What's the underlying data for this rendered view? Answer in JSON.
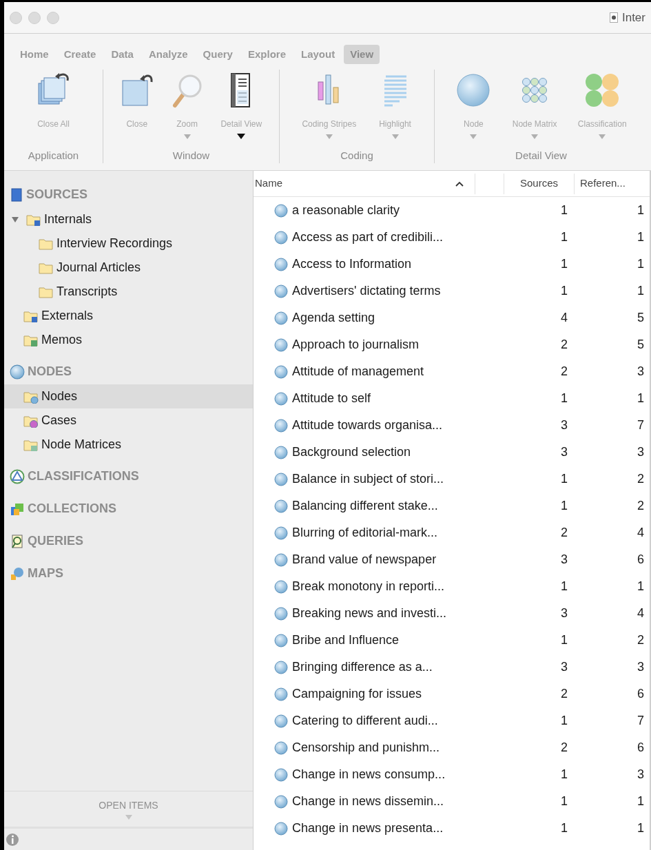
{
  "window": {
    "title": "Inter"
  },
  "ribbon": {
    "tabs": [
      {
        "label": "Home",
        "selected": false
      },
      {
        "label": "Create",
        "selected": false
      },
      {
        "label": "Data",
        "selected": false
      },
      {
        "label": "Analyze",
        "selected": false
      },
      {
        "label": "Query",
        "selected": false
      },
      {
        "label": "Explore",
        "selected": false
      },
      {
        "label": "Layout",
        "selected": false
      },
      {
        "label": "View",
        "selected": true
      }
    ],
    "groups": [
      {
        "label": "Application",
        "buttons": [
          {
            "label": "Close All",
            "kind": "close-all",
            "dropdown": false
          }
        ]
      },
      {
        "label": "Window",
        "buttons": [
          {
            "label": "Close",
            "kind": "close",
            "dropdown": false
          },
          {
            "label": "Zoom",
            "kind": "zoom",
            "dropdown": true,
            "menu_enabled": false
          },
          {
            "label": "Detail View",
            "kind": "detail-view",
            "dropdown": true,
            "menu_enabled": true
          }
        ]
      },
      {
        "label": "Coding",
        "buttons": [
          {
            "label": "Coding Stripes",
            "kind": "coding-stripes",
            "dropdown": true,
            "menu_enabled": false
          },
          {
            "label": "Highlight",
            "kind": "highlight",
            "dropdown": true,
            "menu_enabled": false
          }
        ]
      },
      {
        "label": "Detail View",
        "buttons": [
          {
            "label": "Node",
            "kind": "node",
            "dropdown": true,
            "menu_enabled": false
          },
          {
            "label": "Node Matrix",
            "kind": "node-matrix",
            "dropdown": true,
            "menu_enabled": false
          },
          {
            "label": "Classification",
            "kind": "classification",
            "dropdown": true,
            "menu_enabled": false
          }
        ]
      }
    ]
  },
  "sidebar": {
    "sections": [
      {
        "label": "SOURCES",
        "kind": "sources",
        "items": [
          {
            "label": "Internals",
            "kind": "internals",
            "selected": false,
            "expanded": true,
            "children": [
              {
                "label": "Interview Recordings",
                "selected": false
              },
              {
                "label": "Journal Articles",
                "selected": false
              },
              {
                "label": "Transcripts",
                "selected": false
              }
            ]
          },
          {
            "label": "Externals",
            "kind": "externals",
            "selected": false
          },
          {
            "label": "Memos",
            "kind": "memos",
            "selected": false
          }
        ]
      },
      {
        "label": "NODES",
        "kind": "nodes",
        "items": [
          {
            "label": "Nodes",
            "kind": "nodes",
            "selected": true
          },
          {
            "label": "Cases",
            "kind": "cases",
            "selected": false
          },
          {
            "label": "Node Matrices",
            "kind": "matrices",
            "selected": false
          }
        ]
      },
      {
        "label": "CLASSIFICATIONS",
        "kind": "classifications"
      },
      {
        "label": "COLLECTIONS",
        "kind": "collections"
      },
      {
        "label": "QUERIES",
        "kind": "queries"
      },
      {
        "label": "MAPS",
        "kind": "maps"
      }
    ],
    "footer": {
      "label": "OPEN ITEMS"
    }
  },
  "table": {
    "columns": [
      {
        "label": "Name",
        "sorted": true
      },
      {
        "label": "Sources"
      },
      {
        "label": "Referen..."
      }
    ],
    "rows": [
      {
        "name": "a reasonable clarity",
        "sources": "1",
        "references": "1"
      },
      {
        "name": "Access as part of credibili...",
        "sources": "1",
        "references": "1"
      },
      {
        "name": "Access to Information",
        "sources": "1",
        "references": "1"
      },
      {
        "name": "Advertisers' dictating terms",
        "sources": "1",
        "references": "1"
      },
      {
        "name": "Agenda setting",
        "sources": "4",
        "references": "5"
      },
      {
        "name": "Approach to journalism",
        "sources": "2",
        "references": "5"
      },
      {
        "name": "Attitude of management",
        "sources": "2",
        "references": "3"
      },
      {
        "name": "Attitude to self",
        "sources": "1",
        "references": "1"
      },
      {
        "name": "Attitude towards organisa...",
        "sources": "3",
        "references": "7"
      },
      {
        "name": "Background selection",
        "sources": "3",
        "references": "3"
      },
      {
        "name": "Balance in subject of stori...",
        "sources": "1",
        "references": "2"
      },
      {
        "name": "Balancing different stake...",
        "sources": "1",
        "references": "2"
      },
      {
        "name": "Blurring of editorial-mark...",
        "sources": "2",
        "references": "4"
      },
      {
        "name": "Brand value of newspaper",
        "sources": "3",
        "references": "6"
      },
      {
        "name": "Break monotony in reporti...",
        "sources": "1",
        "references": "1"
      },
      {
        "name": "Breaking news and investi...",
        "sources": "3",
        "references": "4"
      },
      {
        "name": "Bribe and Influence",
        "sources": "1",
        "references": "2"
      },
      {
        "name": "Bringing difference as a...",
        "sources": "3",
        "references": "3"
      },
      {
        "name": "Campaigning for issues",
        "sources": "2",
        "references": "6"
      },
      {
        "name": "Catering to different audi...",
        "sources": "1",
        "references": "7"
      },
      {
        "name": "Censorship and punishm...",
        "sources": "2",
        "references": "6"
      },
      {
        "name": "Change in news consump...",
        "sources": "1",
        "references": "3"
      },
      {
        "name": "Change in news dissemin...",
        "sources": "1",
        "references": "1"
      },
      {
        "name": "Change in news presenta...",
        "sources": "1",
        "references": "1"
      }
    ]
  }
}
